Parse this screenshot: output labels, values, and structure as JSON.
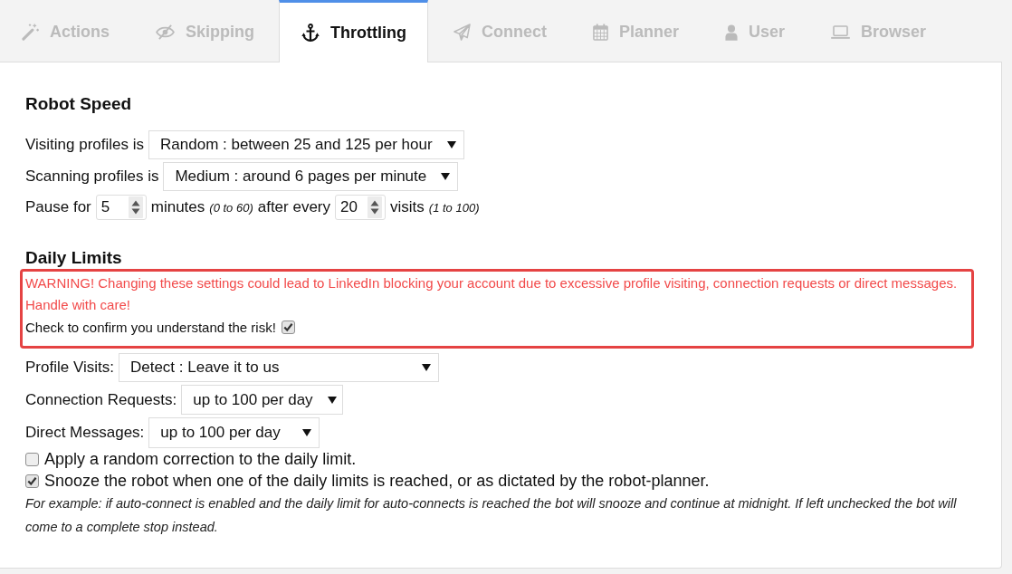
{
  "tabs": [
    {
      "label": "Actions",
      "selected": false
    },
    {
      "label": "Skipping",
      "selected": false
    },
    {
      "label": "Throttling",
      "selected": true
    },
    {
      "label": "Connect",
      "selected": false
    },
    {
      "label": "Planner",
      "selected": false
    },
    {
      "label": "User",
      "selected": false
    },
    {
      "label": "Browser",
      "selected": false
    }
  ],
  "robot_speed": {
    "title": "Robot Speed",
    "settings": [
      {
        "label": "Visiting profiles is",
        "value": "Random : between 25 and 125 per hour"
      },
      {
        "label": "Scanning profiles is",
        "value": "Medium : around 6 pages per minute"
      }
    ],
    "pause": [
      {
        "kind": "text",
        "text": "Pause for"
      },
      {
        "kind": "number",
        "value": "5"
      },
      {
        "kind": "text",
        "text": "minutes"
      },
      {
        "kind": "hint",
        "text": "(0 to 60)"
      },
      {
        "kind": "text",
        "text": "after every"
      },
      {
        "kind": "number",
        "value": "20"
      },
      {
        "kind": "text",
        "text": "visits"
      },
      {
        "kind": "hint",
        "text": "(1 to 100)"
      }
    ]
  },
  "daily_limits": {
    "title": "Daily Limits",
    "warning": {
      "text": "WARNING! Changing these settings could lead to LinkedIn blocking your account due to excessive profile visiting, connection requests or direct messages. Handle with care!",
      "confirm_label": "Check to confirm you understand the risk!",
      "confirmed": true
    },
    "limits": [
      {
        "label": "Profile Visits:",
        "value": "Detect : Leave it to us"
      },
      {
        "label": "Connection Requests:",
        "value": "up to 100 per day"
      },
      {
        "label": "Direct Messages:",
        "value": "up to 100 per day"
      }
    ],
    "options": [
      {
        "label": "Apply a random correction to the daily limit.",
        "checked": false
      },
      {
        "label": "Snooze the robot when one of the daily limits is reached, or as dictated by the robot-planner.",
        "checked": true
      }
    ],
    "note": "For example: if auto-connect is enabled and the daily limit for auto-connects is reached the bot will snooze and continue at midnight. If left unchecked the bot will come to a complete stop instead."
  }
}
